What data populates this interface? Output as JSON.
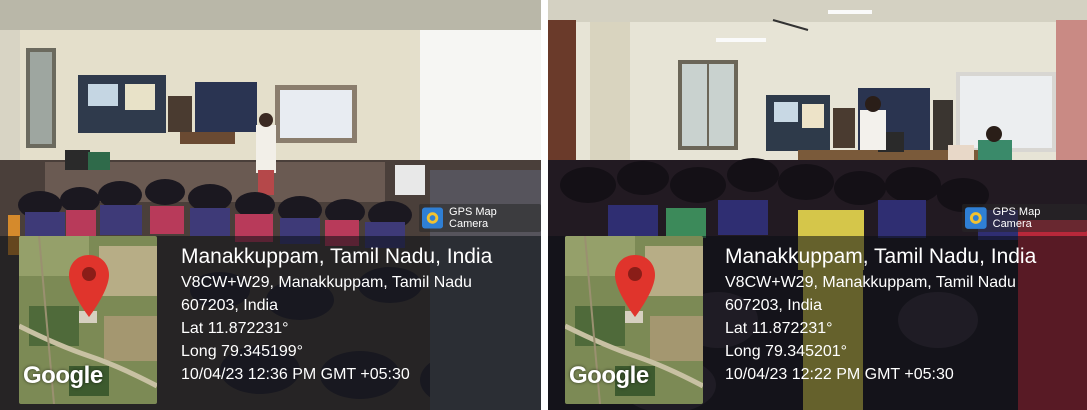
{
  "photos": [
    {
      "badge": {
        "icon": "gps-map-camera-icon",
        "label": "GPS Map Camera"
      },
      "location": {
        "title": "Manakkuppam, Tamil Nadu, India",
        "address_line1": "V8CW+W29, Manakkuppam, Tamil Nadu",
        "address_line2": "607203, India",
        "lat": "Lat 11.872231°",
        "long": "Long 79.345199°",
        "datetime": "10/04/23 12:36 PM GMT +05:30"
      },
      "map": {
        "brand": "Google",
        "pin_icon": "location-pin-icon"
      }
    },
    {
      "badge": {
        "icon": "gps-map-camera-icon",
        "label": "GPS Map Camera"
      },
      "location": {
        "title": "Manakkuppam, Tamil Nadu, India",
        "address_line1": "V8CW+W29, Manakkuppam, Tamil Nadu",
        "address_line2": "607203, India",
        "lat": "Lat 11.872231°",
        "long": "Long 79.345201°",
        "datetime": "10/04/23 12:22 PM GMT +05:30"
      },
      "map": {
        "brand": "Google",
        "pin_icon": "location-pin-icon"
      }
    }
  ],
  "colors": {
    "pin": "#e0342c",
    "badge_icon_bg": "#2f7fd4",
    "overlay": "#0a0e14"
  }
}
